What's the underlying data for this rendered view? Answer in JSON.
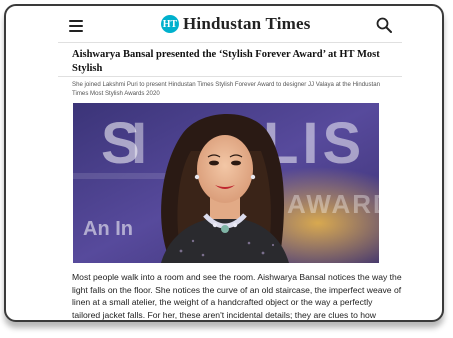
{
  "header": {
    "brand_badge": "HT",
    "brand_name": "Hindustan Times"
  },
  "article": {
    "headline": "Aishwarya Bansal presented the ‘Stylish Forever Award’ at HT Most Stylish",
    "subhead": "She joined Lakshmi Puri to present Hindustan Times Stylish Forever Award to designer JJ Valaya at the Hindustan Times Most Stylish Awards 2020",
    "hero_backdrop_text": "STYLISH",
    "hero_backdrop_sub": "AWARD",
    "hero_backdrop_left": "An In",
    "body": "Most people walk into a room and see the room. Aishwarya Bansal notices the way the light falls on the floor. She notices the curve of an old staircase, the imperfect weave of linen at a small atelier, the weight of a handcrafted object or the way a perfectly tailored jacket falls. For her, these aren't incidental details; they are clues to how something was made and why it feels right."
  },
  "colors": {
    "brand_accent": "#00b1cd",
    "hero_backdrop": "#4a3f8e",
    "text_dark": "#111111"
  }
}
